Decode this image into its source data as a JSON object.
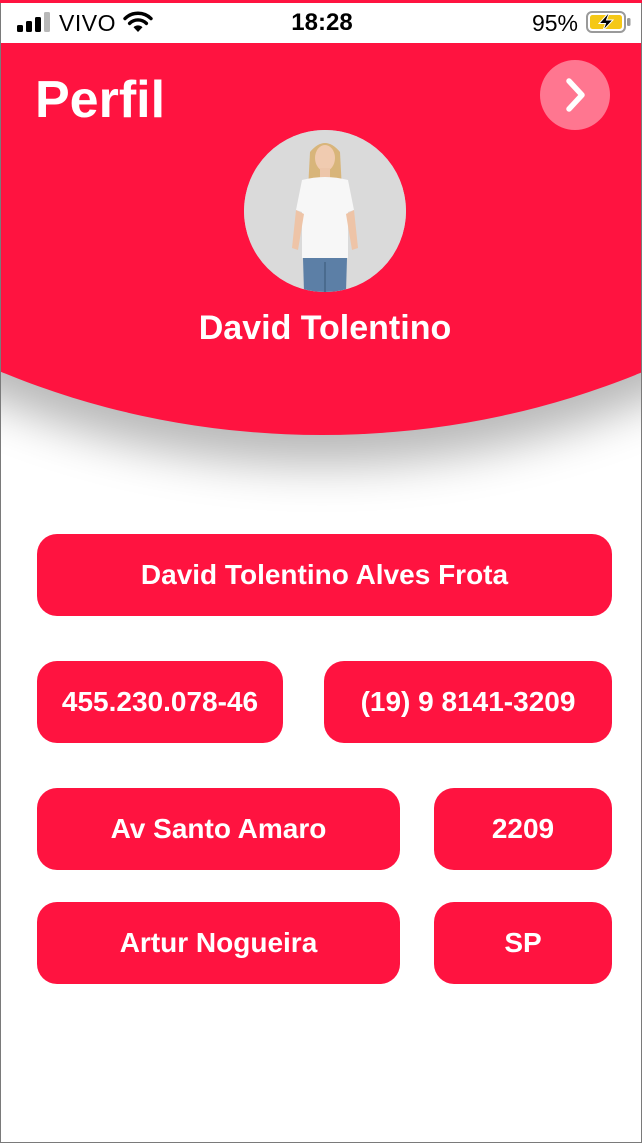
{
  "theme": {
    "accent": "#ff1340",
    "background": "#ffffff"
  },
  "status_bar": {
    "carrier": "VIVO",
    "time": "18:28",
    "battery_percent": "95%",
    "icons": [
      "signal-icon",
      "wifi-icon",
      "battery-charging-icon"
    ]
  },
  "header": {
    "title": "Perfil",
    "next_icon": "chevron-right-icon"
  },
  "profile": {
    "display_name": "David Tolentino"
  },
  "fields": {
    "full_name": "David Tolentino Alves Frota",
    "cpf": "455.230.078-46",
    "phone": "(19) 9 8141-3209",
    "street": "Av Santo Amaro",
    "number": "2209",
    "city": "Artur Nogueira",
    "state": "SP"
  }
}
